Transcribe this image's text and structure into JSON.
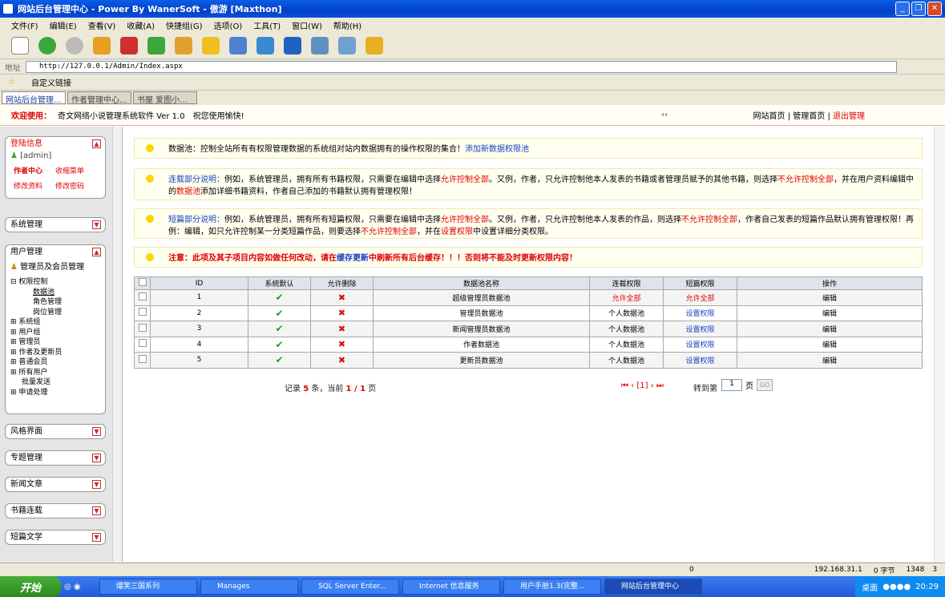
{
  "window": {
    "title": "网站后台管理中心 - Power By WanerSoft - 傲游 [Maxthon]"
  },
  "menu": [
    "文件(F)",
    "编辑(E)",
    "查看(V)",
    "收藏(A)",
    "快捷组(G)",
    "选项(O)",
    "工具(T)",
    "窗口(W)",
    "帮助(H)"
  ],
  "address": {
    "label": "地址",
    "url": "http://127.0.0.1/Admin/Index.aspx"
  },
  "favbar": {
    "label": "自定义链接"
  },
  "tabs": [
    "网站后台管理...",
    "作者管理中心...",
    "书屋 爱图小..."
  ],
  "header": {
    "welcome": "欢迎使用：",
    "product": "奇文网络小说管理系统软件 Ver 1.0",
    "wish": "祝您使用愉快!",
    "collapse": "‹‹",
    "links": [
      "网站首页",
      "管理首页",
      "退出管理"
    ],
    "sep": "|"
  },
  "sidebar": {
    "login": {
      "title": "登陆信息",
      "user": "[admin]",
      "links": [
        "作者中心",
        "收缩菜单",
        "修改资料",
        "修改密码"
      ]
    },
    "system": "系统管理",
    "users": {
      "title": "用户管理",
      "sub": "管理员及会员管理",
      "tree": [
        "⊟ 权限控制",
        "数据池",
        "角色管理",
        "岗位管理",
        "⊞ 系统组",
        "⊞ 用户组",
        "⊞ 管理员",
        "⊞ 作者及更新员",
        "⊞ 普通会员",
        "⊞ 所有用户",
        "批量发送",
        "⊞ 申请处理"
      ]
    },
    "sections": [
      "风格界面",
      "专题管理",
      "新闻文章",
      "书籍连载",
      "短篇文学"
    ]
  },
  "notes": [
    {
      "label": "数据池：",
      "text": "控制全站所有有权限管理数据的系统组对站内数据拥有的操作权限的集合！",
      "link": "添加新数据权限池"
    },
    {
      "label": "连载部分说明：",
      "text1": "例如，系统管理员，拥有所有书籍权限，只需要在编辑中选择",
      "r1": "允许控制全部",
      "text2": "。又例，作者，只允许控制他本人发表的书籍或者管理员赋予的其他书籍，则选择",
      "r2": "不允许控制全部",
      "text3": "，并在用户资料编辑中的",
      "r3": "数据池",
      "text4": "添加详细书籍资料，作者自己添加的书籍默认拥有管理权限！"
    },
    {
      "label": "短篇部分说明：",
      "text1": "例如，系统管理员，拥有所有短篇权限，只需要在编辑中选择",
      "r1": "允许控制全部",
      "text2": "。又例，作者，只允许控制他本人发表的作品，则选择",
      "r2": "不允许控制全部",
      "text3": "，作者自己发表的短篇作品默认拥有管理权限！再例：编辑，如只允许控制某一分类短篇作品，则要选择",
      "r3": "不允许控制全部",
      "text4": "，并在",
      "r4": "设置权限",
      "text5": "中设置详细分类权限。"
    },
    {
      "warn": "注意：此项及其子项目内容如做任何改动，请在",
      "link": "缓存更新",
      "warn2": "中刷新所有后台缓存！！！否则将不能及时更新权限内容！"
    }
  ],
  "table": {
    "headers": [
      "ID",
      "系统默认",
      "允许删除",
      "数据池名称",
      "连载权限",
      "短篇权限",
      "操作"
    ],
    "rows": [
      {
        "id": "1",
        "name": "超级管理员数据池",
        "serial": "允许全部",
        "short": "允许全部",
        "op": "编辑"
      },
      {
        "id": "2",
        "name": "管理员数据池",
        "serial": "个人数据池",
        "short": "设置权限",
        "op": "编辑"
      },
      {
        "id": "3",
        "name": "新闻管理员数据池",
        "serial": "个人数据池",
        "short": "设置权限",
        "op": "编辑"
      },
      {
        "id": "4",
        "name": "作者数据池",
        "serial": "个人数据池",
        "short": "设置权限",
        "op": "编辑"
      },
      {
        "id": "5",
        "name": "更新员数据池",
        "serial": "个人数据池",
        "short": "设置权限",
        "op": "编辑"
      }
    ]
  },
  "pager": {
    "t1": "记录",
    "count": "5",
    "t2": "条，当前",
    "cur": "1 / 1",
    "t3": "页",
    "nav": "⏮ ‹ [1] › ⏭",
    "jump": "转到第",
    "page": "1",
    "unit": "页",
    "go": "GO"
  },
  "status": {
    "ip": "192.168.31.1",
    "bytes": "0 字节",
    "size": "1348",
    "num": "3",
    "zero": "0"
  },
  "taskbar": {
    "start": "开始",
    "tasks": [
      "爆笑三国系列",
      "Manages",
      "SQL Server Enter...",
      "Internet 信息服务",
      "用户手册1.3(完整...",
      "网站后台管理中心"
    ],
    "desktop": "桌面",
    "time": "20:29"
  }
}
